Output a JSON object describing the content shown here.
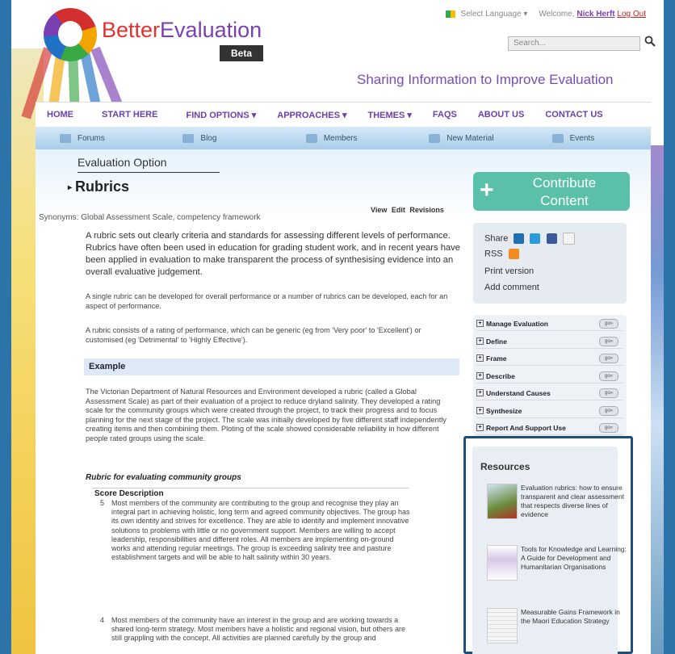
{
  "header": {
    "brand": "BetterEvaluation",
    "brand_part1": "Better",
    "brand_part2": "Evaluation",
    "beta": "Beta",
    "tagline": "Sharing Information to Improve Evaluation",
    "select_language": "Select Language",
    "welcome": "Welcome,",
    "user": "Nick Herft",
    "logout": "Log Out",
    "search_placeholder": "Search..."
  },
  "nav": [
    "HOME",
    "START HERE",
    "FIND OPTIONS ▾",
    "APPROACHES ▾",
    "THEMES ▾",
    "FAQS",
    "ABOUT US",
    "CONTACT US"
  ],
  "subnav": [
    "Forums",
    "Blog",
    "Members",
    "New Material",
    "Events"
  ],
  "page": {
    "section_label": "Evaluation Option",
    "title": "Rubrics",
    "tabs": "View Edit Revisions",
    "synonyms": "Synonyms: Global Assessment Scale, competency framework",
    "intro": "A rubric sets out clearly criteria and standards for assessing different levels of performance. Rubrics have often been used in education for grading student work, and in recent years have been applied in evaluation to make transparent the process of synthesising evidence into an overall evaluative judgement.",
    "para2": "A single rubric can be developed for overall performance or a number of rubrics can be developed, each for an aspect of performance.",
    "para3": "A rubric consists of a rating of performance, which can be generic (eg from 'Very poor' to 'Excellent') or customised (eg 'Detrimental' to 'Highly Effective').",
    "example_heading": "Example",
    "example_text": "The Victorian Department of Natural Resources and Environment developed a rubric (called a Global Assessment Scale) as part of their evaluation of a project to reduce dryland salinity. They developed a rating scale for the community groups which were created through the project, to track their progress and to focus planning for the next stage of the project. The scale was initially developed by five different staff independently creating items and then combining them. Ploting of the scale showed considerable reliability in how different people rated groups using the scale.",
    "rubric_heading": "Rubric for evaluating community groups",
    "score_col": "Score",
    "desc_col": "Description",
    "scores": [
      {
        "score": "5",
        "text": "Most members of the community are contributing to the group and recognise they play an integral part in achieving holistic, long term and agreed community objectives. The group has its own identity and strives for excellence. They are able to identify and implement innovative solutions to problems with little or no government support. Members are willing to accept leadership, responsibilities and different roles. All members are implementing on-ground works and attending regular meetings. The group is exceeding salinity tree and pasture establishment targets and will be able to halt salinity within 30 years."
      },
      {
        "score": "4",
        "text": "Most members of the community have an interest in the group and are working towards a shared long-term strategy. Most members have a holistic and regional vision, but others are still grappling with the concept. All activities are planned carefully by the group and"
      }
    ]
  },
  "sidebar": {
    "contribute": "Contribute\nContent",
    "share_label": "Share",
    "rss_label": "RSS",
    "print_label": "Print version",
    "comment_label": "Add comment",
    "menu": [
      "Manage Evaluation",
      "Define",
      "Frame",
      "Describe",
      "Understand Causes",
      "Synthesize",
      "Report And Support Use"
    ],
    "go_label": "go»",
    "resources_title": "Resources",
    "resources": [
      "Evaluation rubrics: how to ensure transparent and clear assessment that respects diverse lines of evidence",
      "Tools for Knowledge and Learning: A Guide for Development and Humanitarian Organisations",
      "Measurable Gains Framework in the Maori Education Strategy"
    ]
  },
  "colors": {
    "page_bg": "#2b73a8",
    "brand_red": "#e0332f",
    "brand_purple": "#7a3fb0",
    "contribute_green": "#5ac0aa",
    "resources_border": "#1c4f7c"
  }
}
